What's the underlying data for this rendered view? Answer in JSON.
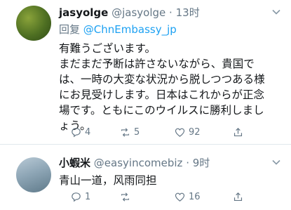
{
  "tweets": [
    {
      "display_name": "jasyolge",
      "handle": "@jasyolge",
      "dot": "·",
      "time": "13时",
      "reply_label": "回复",
      "reply_to": "@ChnEmbassy_jp",
      "text_lines": [
        "有難うございます。",
        "まだまだ予断は許さないながら、貴国で",
        "は、一時の大変な状況から脱しつつある様",
        "にお見受けします。日本はこれからが正念",
        "場です。ともにこのウイルスに勝利しまし",
        "ょう。"
      ],
      "replies": "4",
      "retweets": "5",
      "likes": "92"
    },
    {
      "display_name": "小蝦米",
      "handle": "@easyincomebiz",
      "dot": "·",
      "time": "9时",
      "text": "青山一道，风雨同担",
      "replies": "1",
      "retweets": "",
      "likes": "16"
    }
  ],
  "colors": {
    "accent": "#1da1f2",
    "secondary_text": "#657786",
    "divider": "#e1e8ed"
  },
  "icons": [
    "chevron-down-icon",
    "reply-icon",
    "retweet-icon",
    "like-icon",
    "share-icon"
  ]
}
